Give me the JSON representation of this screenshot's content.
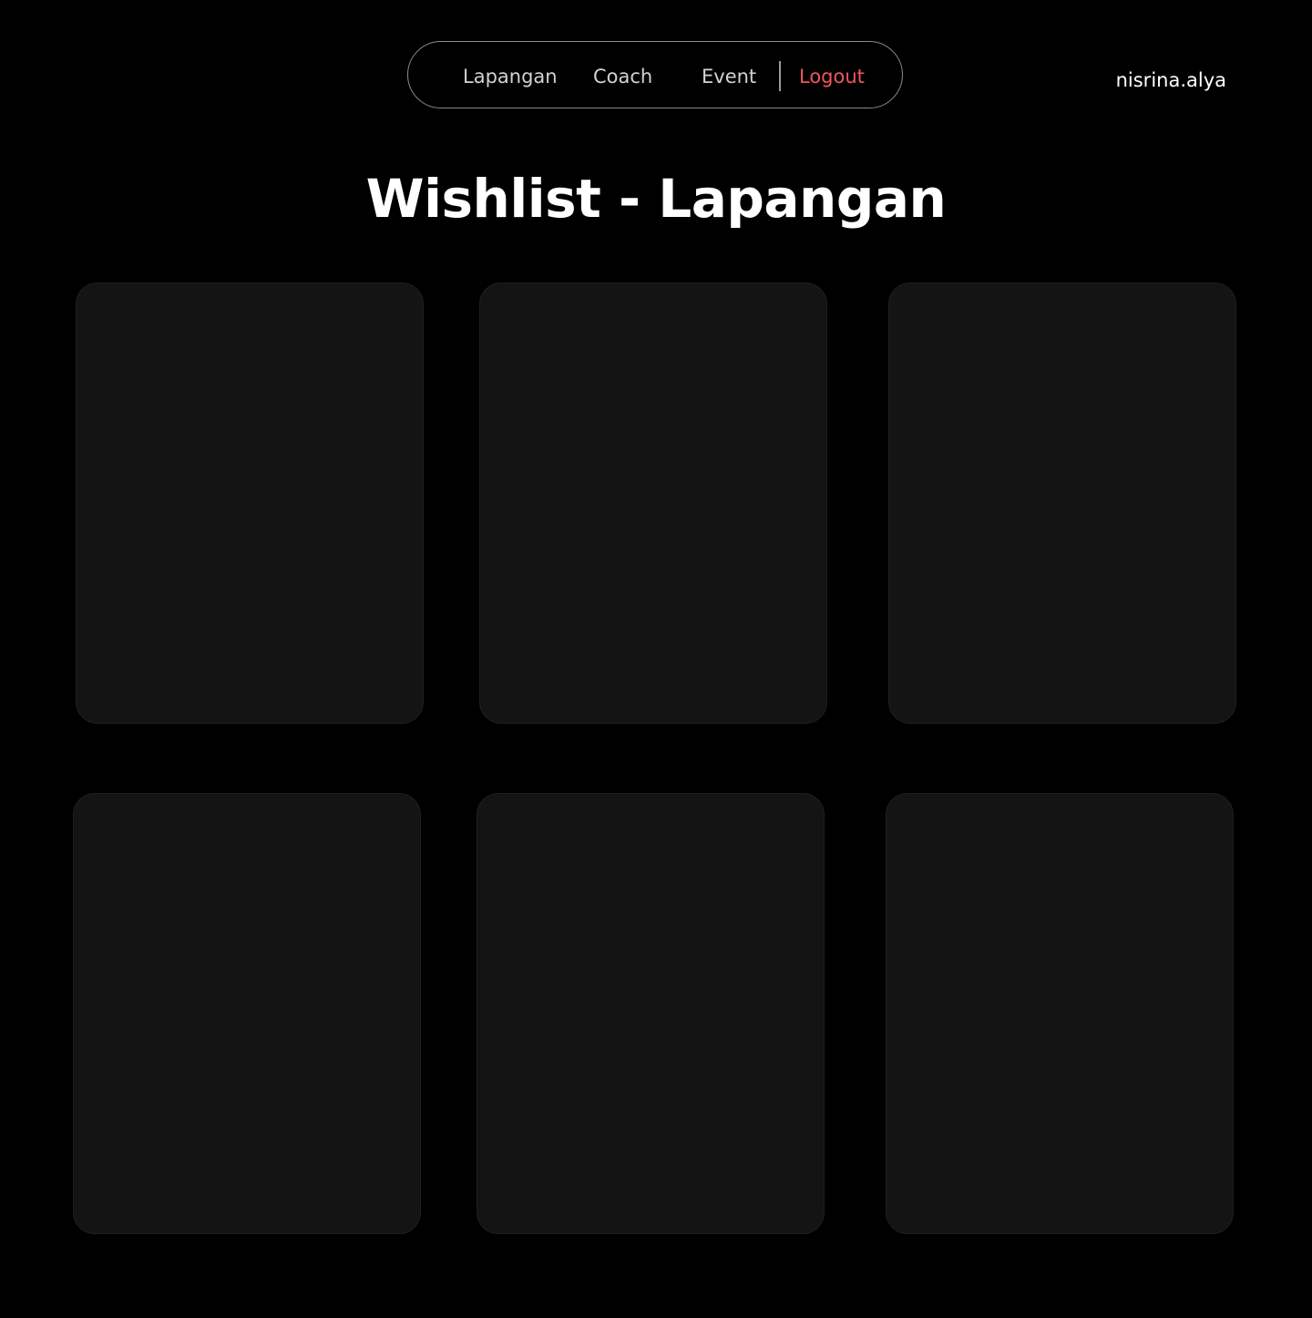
{
  "nav": {
    "links": [
      {
        "label": "Lapangan"
      },
      {
        "label": "Coach"
      },
      {
        "label": "Event"
      }
    ],
    "logout_label": "Logout",
    "logout_color": "#f0555e"
  },
  "user": {
    "username": "nisrina.alya"
  },
  "page": {
    "title": "Wishlist - Lapangan"
  },
  "wishlist": {
    "card_count_visible": 6,
    "card_background": "#141414"
  },
  "colors": {
    "background": "#000000",
    "text": "#ffffff",
    "nav_text": "#d2d2d2",
    "accent": "#f0555e"
  }
}
